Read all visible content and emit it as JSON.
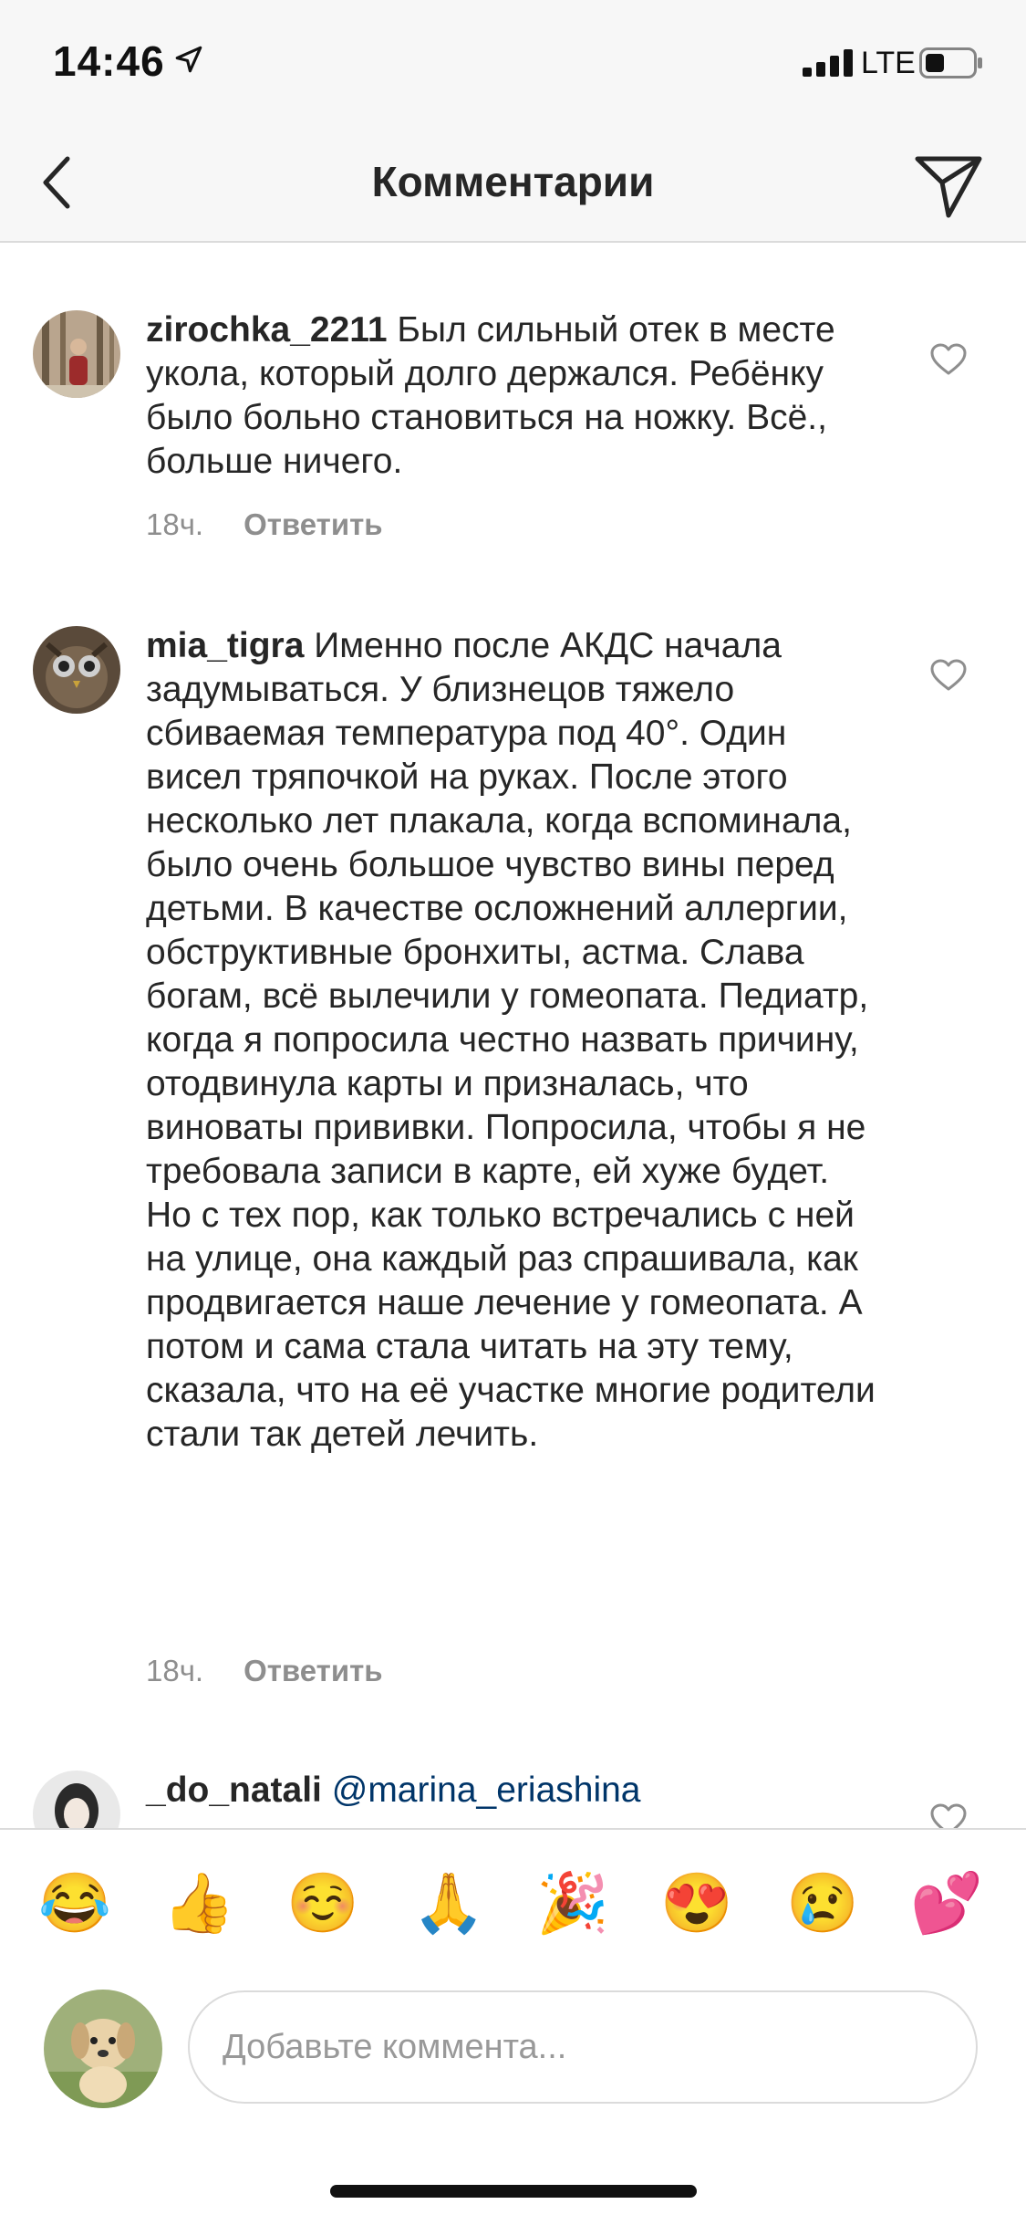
{
  "status_bar": {
    "time": "14:46",
    "network": "LTE"
  },
  "header": {
    "title": "Комментарии"
  },
  "comments": [
    {
      "username": "zirochka_2211",
      "text": " Был сильный отек в месте укола, который долго держался. Ребёнку было больно становиться на ножку. Всё., больше ничего.",
      "time": "18ч.",
      "reply_label": "Ответить"
    },
    {
      "username": "mia_tigra",
      "text": " Именно после АКДС начала задумываться. У близнецов тяжело сбиваемая температура под 40°. Один висел тряпочкой на руках. После этого несколько лет плакала, когда вспоминала, было очень большое чувство вины перед детьми. В качестве осложнений аллергии, обструктивные бронхиты, астма. Слава богам, всё вылечили у гомеопата. Педиатр, когда я попросила честно назвать причину, отодвинула карты и призналась, что виноваты прививки. Попросила, чтобы я не требовала записи в карте, ей хуже будет. Но с тех пор, как только встречались с ней на улице, она каждый раз спрашивала, как продвигается наше лечение у гомеопата. А потом и сама стала читать на эту тему, сказала, что на её участке многие родители стали так детей лечить.",
      "time": "18ч.",
      "reply_label": "Ответить"
    },
    {
      "username": "_do_natali",
      "mention": "@marina_eriashina"
    }
  ],
  "emoji_bar": [
    "😂",
    "👍",
    "☺️",
    "🙏",
    "🎉",
    "😍",
    "😢",
    "💕"
  ],
  "composer": {
    "placeholder": "Добавьте коммента..."
  },
  "colors": {
    "link": "#003569",
    "muted": "#8e8e8e",
    "border": "#dbdbdb",
    "bar_bg": "#f7f7f7"
  }
}
